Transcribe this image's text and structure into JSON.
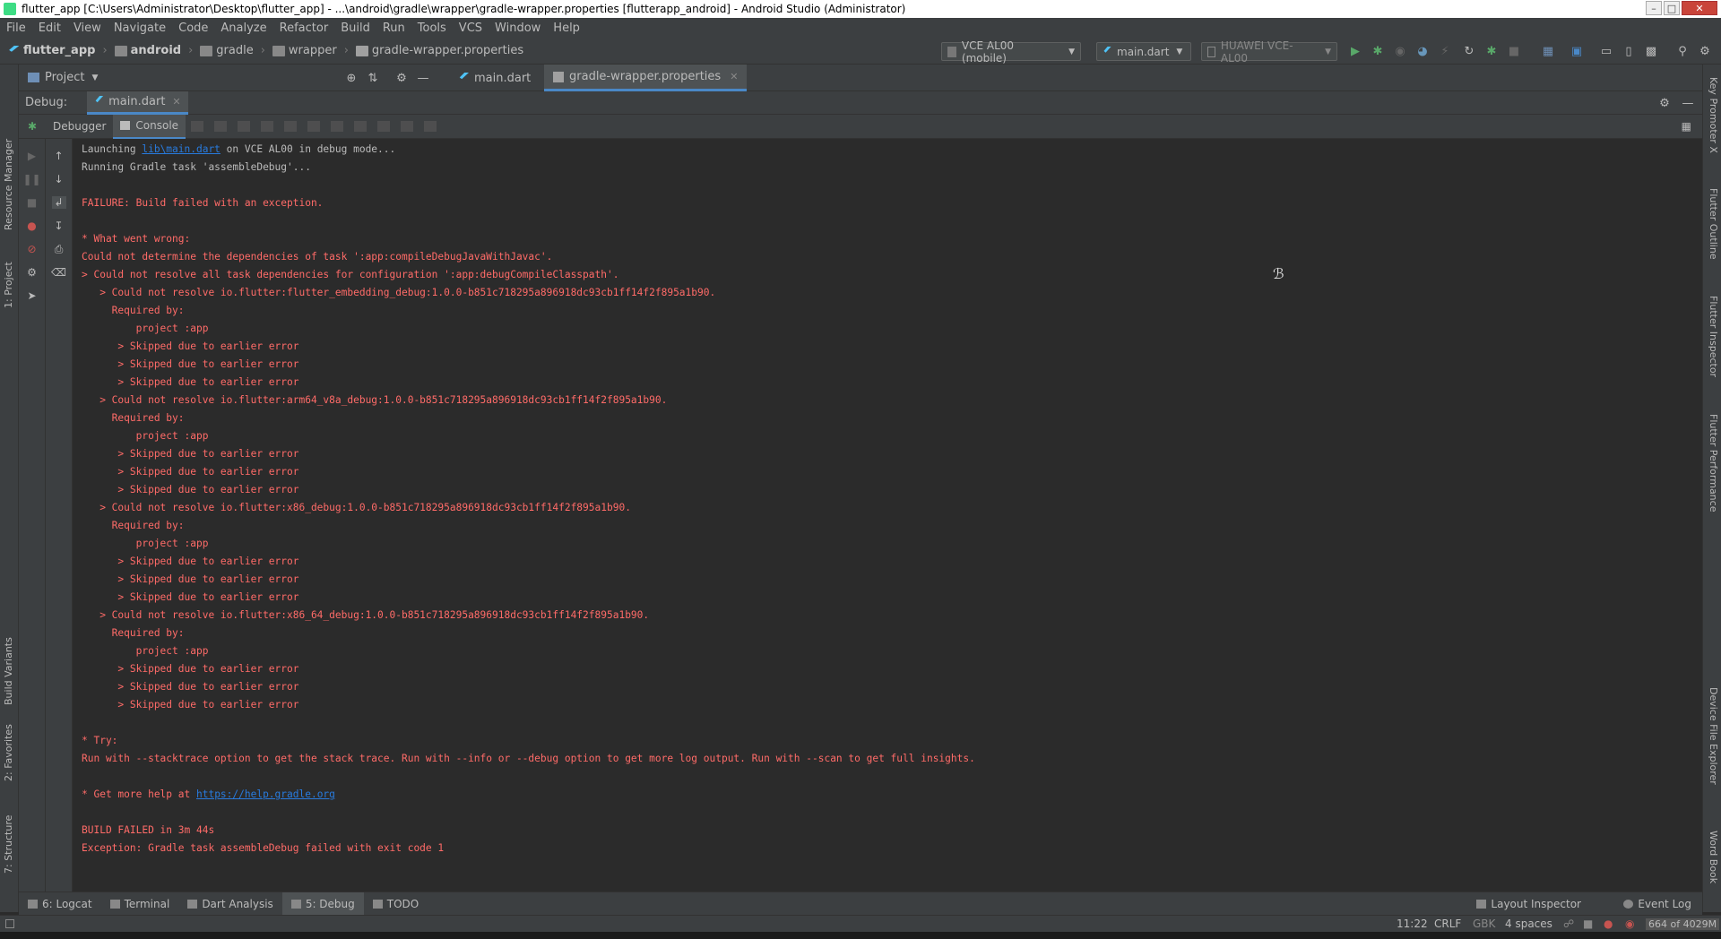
{
  "window": {
    "title": "flutter_app [C:\\Users\\Administrator\\Desktop\\flutter_app] - ...\\android\\gradle\\wrapper\\gradle-wrapper.properties [flutterapp_android] - Android Studio (Administrator)"
  },
  "menubar": [
    "File",
    "Edit",
    "View",
    "Navigate",
    "Code",
    "Analyze",
    "Refactor",
    "Build",
    "Run",
    "Tools",
    "VCS",
    "Window",
    "Help"
  ],
  "breadcrumb": [
    "flutter_app",
    "android",
    "gradle",
    "wrapper",
    "gradle-wrapper.properties"
  ],
  "toolbar": {
    "device_selector": "VCE AL00 (mobile)",
    "run_config": "main.dart",
    "device_target": "HUAWEI VCE-AL00"
  },
  "project_panel": {
    "label": "Project"
  },
  "editor_tabs": [
    {
      "label": "main.dart",
      "active": false
    },
    {
      "label": "gradle-wrapper.properties",
      "active": true
    }
  ],
  "debug_panel": {
    "label": "Debug:",
    "session_tab": "main.dart",
    "subtabs": [
      "Debugger",
      "Console"
    ]
  },
  "left_stripe": [
    "Resource Manager",
    "1: Project",
    "Build Variants",
    "2: Favorites",
    "7: Structure"
  ],
  "right_stripe": [
    "Key Promoter X",
    "Flutter Outline",
    "Flutter Inspector",
    "Flutter Performance",
    "Device File Explorer",
    "Word Book"
  ],
  "console_lines": [
    {
      "type": "info",
      "text": "Launching ",
      "link": "lib\\main.dart",
      "after": " on VCE AL00 in debug mode..."
    },
    {
      "type": "info",
      "text": "Running Gradle task 'assembleDebug'..."
    },
    {
      "type": "blank",
      "text": ""
    },
    {
      "type": "err",
      "text": "FAILURE: Build failed with an exception."
    },
    {
      "type": "blank",
      "text": ""
    },
    {
      "type": "err",
      "text": "* What went wrong:"
    },
    {
      "type": "err",
      "text": "Could not determine the dependencies of task ':app:compileDebugJavaWithJavac'."
    },
    {
      "type": "err",
      "text": "> Could not resolve all task dependencies for configuration ':app:debugCompileClasspath'."
    },
    {
      "type": "err",
      "text": "   > Could not resolve io.flutter:flutter_embedding_debug:1.0.0-b851c718295a896918dc93cb1ff14f2f895a1b90."
    },
    {
      "type": "err",
      "text": "     Required by:"
    },
    {
      "type": "err",
      "text": "         project :app"
    },
    {
      "type": "err",
      "text": "      > Skipped due to earlier error"
    },
    {
      "type": "err",
      "text": "      > Skipped due to earlier error"
    },
    {
      "type": "err",
      "text": "      > Skipped due to earlier error"
    },
    {
      "type": "err",
      "text": "   > Could not resolve io.flutter:arm64_v8a_debug:1.0.0-b851c718295a896918dc93cb1ff14f2f895a1b90."
    },
    {
      "type": "err",
      "text": "     Required by:"
    },
    {
      "type": "err",
      "text": "         project :app"
    },
    {
      "type": "err",
      "text": "      > Skipped due to earlier error"
    },
    {
      "type": "err",
      "text": "      > Skipped due to earlier error"
    },
    {
      "type": "err",
      "text": "      > Skipped due to earlier error"
    },
    {
      "type": "err",
      "text": "   > Could not resolve io.flutter:x86_debug:1.0.0-b851c718295a896918dc93cb1ff14f2f895a1b90."
    },
    {
      "type": "err",
      "text": "     Required by:"
    },
    {
      "type": "err",
      "text": "         project :app"
    },
    {
      "type": "err",
      "text": "      > Skipped due to earlier error"
    },
    {
      "type": "err",
      "text": "      > Skipped due to earlier error"
    },
    {
      "type": "err",
      "text": "      > Skipped due to earlier error"
    },
    {
      "type": "err",
      "text": "   > Could not resolve io.flutter:x86_64_debug:1.0.0-b851c718295a896918dc93cb1ff14f2f895a1b90."
    },
    {
      "type": "err",
      "text": "     Required by:"
    },
    {
      "type": "err",
      "text": "         project :app"
    },
    {
      "type": "err",
      "text": "      > Skipped due to earlier error"
    },
    {
      "type": "err",
      "text": "      > Skipped due to earlier error"
    },
    {
      "type": "err",
      "text": "      > Skipped due to earlier error"
    },
    {
      "type": "blank",
      "text": ""
    },
    {
      "type": "err",
      "text": "* Try:"
    },
    {
      "type": "err",
      "text": "Run with --stacktrace option to get the stack trace. Run with --info or --debug option to get more log output. Run with --scan to get full insights."
    },
    {
      "type": "blank",
      "text": ""
    },
    {
      "type": "err",
      "text": "* Get more help at ",
      "link": "https://help.gradle.org",
      "after": ""
    },
    {
      "type": "blank",
      "text": ""
    },
    {
      "type": "err",
      "text": "BUILD FAILED in 3m 44s"
    },
    {
      "type": "err",
      "text": "Exception: Gradle task assembleDebug failed with exit code 1"
    }
  ],
  "bottom_tabs": [
    {
      "label": "6: Logcat",
      "active": false
    },
    {
      "label": "Terminal",
      "active": false
    },
    {
      "label": "Dart Analysis",
      "active": false
    },
    {
      "label": "5: Debug",
      "active": true
    },
    {
      "label": "TODO",
      "active": false
    }
  ],
  "bottom_right_tabs": [
    "Layout Inspector",
    "Event Log"
  ],
  "statusbar": {
    "position": "11:22",
    "line_sep": "CRLF",
    "encoding": "GBK",
    "indent": "4 spaces",
    "memory": "664 of 4029M"
  },
  "colors": {
    "error_text": "#ff6b68",
    "info_text": "#bbbbbb",
    "link": "#287bde",
    "accent": "#4a88c7"
  }
}
